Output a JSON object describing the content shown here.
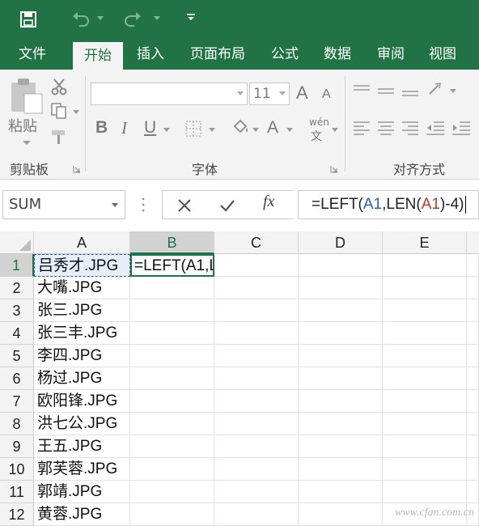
{
  "tabs": [
    "文件",
    "开始",
    "插入",
    "页面布局",
    "公式",
    "数据",
    "审阅",
    "视图"
  ],
  "ribbon": {
    "clipboard": {
      "paste": "粘贴",
      "label": "剪贴板"
    },
    "font": {
      "size": "11",
      "label": "字体",
      "bold": "B",
      "italic": "I",
      "underline": "U",
      "grow": "A",
      "shrink": "A",
      "color": "A",
      "wen": "wén"
    },
    "align": {
      "label": "对齐方式"
    }
  },
  "formula_bar": {
    "namebox": "SUM",
    "fx": "fx",
    "formula": {
      "prefix": "=LEFT(",
      "ref1": "A1",
      "mid": ",LEN(",
      "ref2": "A1",
      "suffix": ")-4)"
    }
  },
  "grid": {
    "columns": [
      "A",
      "B",
      "C",
      "D",
      "E"
    ],
    "rows": [
      {
        "num": "1",
        "a": "吕秀才.JPG",
        "b": "=LEFT(A1,L"
      },
      {
        "num": "2",
        "a": "大嘴.JPG",
        "b": ""
      },
      {
        "num": "3",
        "a": "张三.JPG",
        "b": ""
      },
      {
        "num": "4",
        "a": "张三丰.JPG",
        "b": ""
      },
      {
        "num": "5",
        "a": "李四.JPG",
        "b": ""
      },
      {
        "num": "6",
        "a": "杨过.JPG",
        "b": ""
      },
      {
        "num": "7",
        "a": "欧阳锋.JPG",
        "b": ""
      },
      {
        "num": "8",
        "a": "洪七公.JPG",
        "b": ""
      },
      {
        "num": "9",
        "a": "王五.JPG",
        "b": ""
      },
      {
        "num": "10",
        "a": "郭芙蓉.JPG",
        "b": ""
      },
      {
        "num": "11",
        "a": "郭靖.JPG",
        "b": ""
      },
      {
        "num": "12",
        "a": "黄蓉.JPG",
        "b": ""
      }
    ]
  },
  "watermark": "www.cfan.com.cn",
  "colors": {
    "accent": "#217346",
    "ref1": "#2b5fb8",
    "ref2": "#c0392b"
  }
}
